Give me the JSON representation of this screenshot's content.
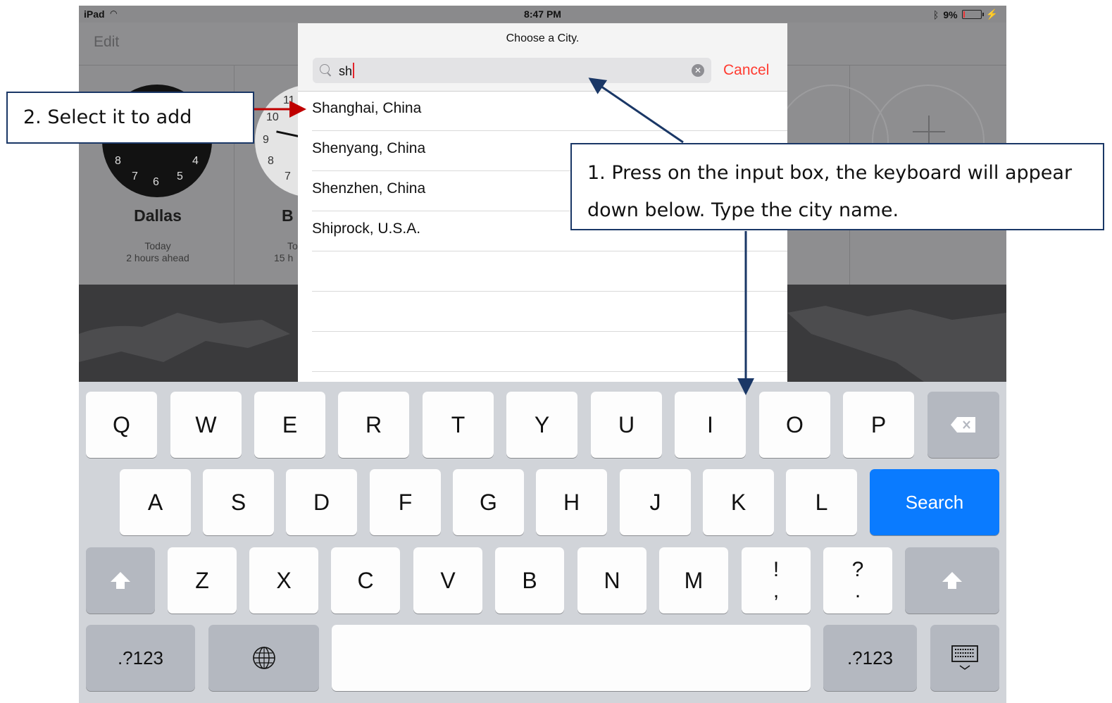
{
  "status": {
    "device": "iPad",
    "time": "8:47 PM",
    "battery": "9%",
    "battery_level": 0.09
  },
  "background": {
    "edit": "Edit",
    "clock1": {
      "city": "Dallas",
      "day": "Today",
      "offset": "2 hours ahead",
      "numerals": [
        "8",
        "7",
        "6",
        "5",
        "4"
      ]
    },
    "clock2": {
      "city_partial": "B",
      "day_partial": "To",
      "offset_partial": "15 h",
      "numerals": [
        "11",
        "10",
        "9",
        "8",
        "7"
      ]
    }
  },
  "modal": {
    "title": "Choose a City.",
    "search_value": "sh",
    "cancel": "Cancel",
    "results": [
      "Shanghai, China",
      "Shenyang, China",
      "Shenzhen, China",
      "Shiprock, U.S.A."
    ]
  },
  "keyboard": {
    "row1": [
      "Q",
      "W",
      "E",
      "R",
      "T",
      "Y",
      "U",
      "I",
      "O",
      "P"
    ],
    "row2": [
      "A",
      "S",
      "D",
      "F",
      "G",
      "H",
      "J",
      "K",
      "L"
    ],
    "row3": [
      "Z",
      "X",
      "C",
      "V",
      "B",
      "N",
      "M"
    ],
    "punct1_top": "!",
    "punct1_bottom": ",",
    "punct2_top": "?",
    "punct2_bottom": ".",
    "search": "Search",
    "numbers": ".?123",
    "numbers_right": ".?123"
  },
  "annotations": {
    "step1": "1. Press on the input box, the keyboard will appear down below.  Type the city name.",
    "step2": "2. Select it to add"
  }
}
